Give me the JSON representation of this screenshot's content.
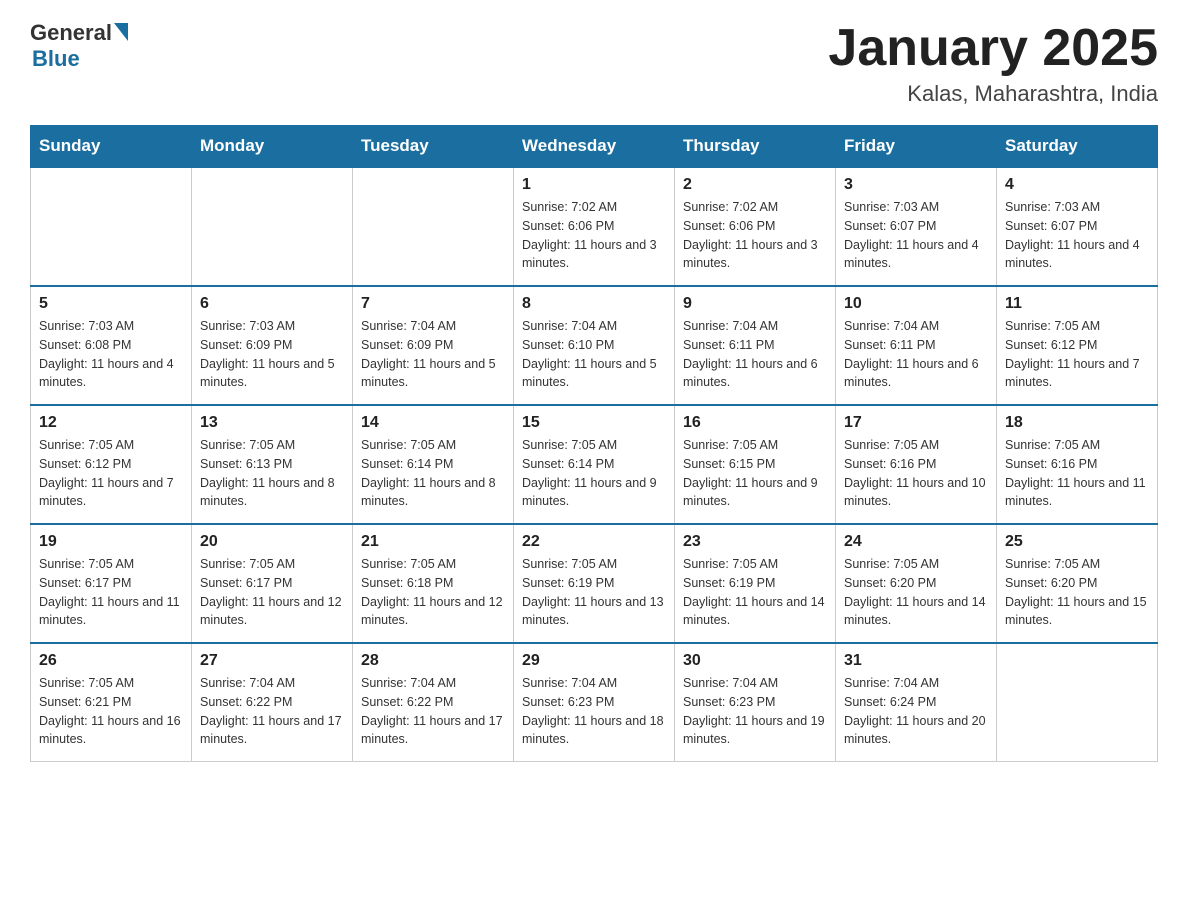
{
  "header": {
    "logo_general": "General",
    "logo_blue": "Blue",
    "title": "January 2025",
    "subtitle": "Kalas, Maharashtra, India"
  },
  "days_of_week": [
    "Sunday",
    "Monday",
    "Tuesday",
    "Wednesday",
    "Thursday",
    "Friday",
    "Saturday"
  ],
  "weeks": [
    [
      {
        "day": "",
        "info": ""
      },
      {
        "day": "",
        "info": ""
      },
      {
        "day": "",
        "info": ""
      },
      {
        "day": "1",
        "info": "Sunrise: 7:02 AM\nSunset: 6:06 PM\nDaylight: 11 hours and 3 minutes."
      },
      {
        "day": "2",
        "info": "Sunrise: 7:02 AM\nSunset: 6:06 PM\nDaylight: 11 hours and 3 minutes."
      },
      {
        "day": "3",
        "info": "Sunrise: 7:03 AM\nSunset: 6:07 PM\nDaylight: 11 hours and 4 minutes."
      },
      {
        "day": "4",
        "info": "Sunrise: 7:03 AM\nSunset: 6:07 PM\nDaylight: 11 hours and 4 minutes."
      }
    ],
    [
      {
        "day": "5",
        "info": "Sunrise: 7:03 AM\nSunset: 6:08 PM\nDaylight: 11 hours and 4 minutes."
      },
      {
        "day": "6",
        "info": "Sunrise: 7:03 AM\nSunset: 6:09 PM\nDaylight: 11 hours and 5 minutes."
      },
      {
        "day": "7",
        "info": "Sunrise: 7:04 AM\nSunset: 6:09 PM\nDaylight: 11 hours and 5 minutes."
      },
      {
        "day": "8",
        "info": "Sunrise: 7:04 AM\nSunset: 6:10 PM\nDaylight: 11 hours and 5 minutes."
      },
      {
        "day": "9",
        "info": "Sunrise: 7:04 AM\nSunset: 6:11 PM\nDaylight: 11 hours and 6 minutes."
      },
      {
        "day": "10",
        "info": "Sunrise: 7:04 AM\nSunset: 6:11 PM\nDaylight: 11 hours and 6 minutes."
      },
      {
        "day": "11",
        "info": "Sunrise: 7:05 AM\nSunset: 6:12 PM\nDaylight: 11 hours and 7 minutes."
      }
    ],
    [
      {
        "day": "12",
        "info": "Sunrise: 7:05 AM\nSunset: 6:12 PM\nDaylight: 11 hours and 7 minutes."
      },
      {
        "day": "13",
        "info": "Sunrise: 7:05 AM\nSunset: 6:13 PM\nDaylight: 11 hours and 8 minutes."
      },
      {
        "day": "14",
        "info": "Sunrise: 7:05 AM\nSunset: 6:14 PM\nDaylight: 11 hours and 8 minutes."
      },
      {
        "day": "15",
        "info": "Sunrise: 7:05 AM\nSunset: 6:14 PM\nDaylight: 11 hours and 9 minutes."
      },
      {
        "day": "16",
        "info": "Sunrise: 7:05 AM\nSunset: 6:15 PM\nDaylight: 11 hours and 9 minutes."
      },
      {
        "day": "17",
        "info": "Sunrise: 7:05 AM\nSunset: 6:16 PM\nDaylight: 11 hours and 10 minutes."
      },
      {
        "day": "18",
        "info": "Sunrise: 7:05 AM\nSunset: 6:16 PM\nDaylight: 11 hours and 11 minutes."
      }
    ],
    [
      {
        "day": "19",
        "info": "Sunrise: 7:05 AM\nSunset: 6:17 PM\nDaylight: 11 hours and 11 minutes."
      },
      {
        "day": "20",
        "info": "Sunrise: 7:05 AM\nSunset: 6:17 PM\nDaylight: 11 hours and 12 minutes."
      },
      {
        "day": "21",
        "info": "Sunrise: 7:05 AM\nSunset: 6:18 PM\nDaylight: 11 hours and 12 minutes."
      },
      {
        "day": "22",
        "info": "Sunrise: 7:05 AM\nSunset: 6:19 PM\nDaylight: 11 hours and 13 minutes."
      },
      {
        "day": "23",
        "info": "Sunrise: 7:05 AM\nSunset: 6:19 PM\nDaylight: 11 hours and 14 minutes."
      },
      {
        "day": "24",
        "info": "Sunrise: 7:05 AM\nSunset: 6:20 PM\nDaylight: 11 hours and 14 minutes."
      },
      {
        "day": "25",
        "info": "Sunrise: 7:05 AM\nSunset: 6:20 PM\nDaylight: 11 hours and 15 minutes."
      }
    ],
    [
      {
        "day": "26",
        "info": "Sunrise: 7:05 AM\nSunset: 6:21 PM\nDaylight: 11 hours and 16 minutes."
      },
      {
        "day": "27",
        "info": "Sunrise: 7:04 AM\nSunset: 6:22 PM\nDaylight: 11 hours and 17 minutes."
      },
      {
        "day": "28",
        "info": "Sunrise: 7:04 AM\nSunset: 6:22 PM\nDaylight: 11 hours and 17 minutes."
      },
      {
        "day": "29",
        "info": "Sunrise: 7:04 AM\nSunset: 6:23 PM\nDaylight: 11 hours and 18 minutes."
      },
      {
        "day": "30",
        "info": "Sunrise: 7:04 AM\nSunset: 6:23 PM\nDaylight: 11 hours and 19 minutes."
      },
      {
        "day": "31",
        "info": "Sunrise: 7:04 AM\nSunset: 6:24 PM\nDaylight: 11 hours and 20 minutes."
      },
      {
        "day": "",
        "info": ""
      }
    ]
  ]
}
